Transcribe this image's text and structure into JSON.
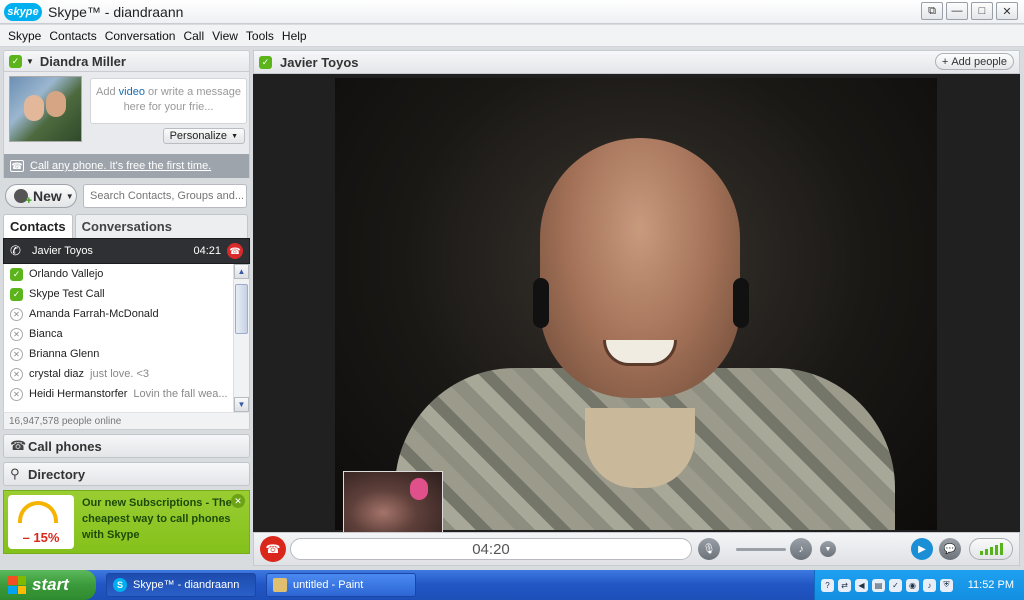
{
  "window": {
    "logo": "skype",
    "title": "Skype™ - diandraann",
    "controls": [
      "restore-icon",
      "minimize-icon",
      "maximize-icon",
      "close-icon"
    ]
  },
  "menu": [
    "Skype",
    "Contacts",
    "Conversation",
    "Call",
    "View",
    "Tools",
    "Help"
  ],
  "profile": {
    "name": "Diandra Miller",
    "mood_prefix": "Add",
    "mood_link": "video",
    "mood_suffix": "or write a message here for your frie...",
    "personalize_label": "Personalize",
    "call_phone_link": "Call any phone. It's free the first time."
  },
  "toolbar": {
    "new_label": "New",
    "search_placeholder": "Search Contacts, Groups and..."
  },
  "tabs": {
    "contacts": "Contacts",
    "conversations": "Conversations"
  },
  "active_call": {
    "name": "Javier Toyos",
    "time": "04:21"
  },
  "contacts": [
    {
      "name": "Orlando Vallejo",
      "mood": "",
      "status": "online"
    },
    {
      "name": "Skype Test Call",
      "mood": "",
      "status": "online"
    },
    {
      "name": "Amanda Farrah-McDonald",
      "mood": "",
      "status": "offline"
    },
    {
      "name": "Bianca",
      "mood": "",
      "status": "offline"
    },
    {
      "name": "Brianna Glenn",
      "mood": "",
      "status": "offline"
    },
    {
      "name": "crystal diaz",
      "mood": "just love. <3",
      "status": "offline"
    },
    {
      "name": "Heidi Hermanstorfer",
      "mood": "Lovin the fall wea...",
      "status": "offline"
    }
  ],
  "online_count": "16,947,578 people online",
  "sections": {
    "call_phones": "Call phones",
    "directory": "Directory"
  },
  "promo": {
    "badge": "– 15%",
    "text": "Our new Subscriptions - The cheapest way to call phones with Skype"
  },
  "conversation": {
    "name": "Javier Toyos",
    "add_people_label": "Add people",
    "timer": "04:20"
  },
  "taskbar": {
    "start_label": "start",
    "tasks": [
      "Skype™ - diandraann",
      "untitled - Paint"
    ],
    "clock": "11:52 PM"
  },
  "colors": {
    "skype_blue": "#00aff0",
    "online_green": "#5bb41a",
    "hangup_red": "#d9281b",
    "promo_green": "#9acd32"
  }
}
